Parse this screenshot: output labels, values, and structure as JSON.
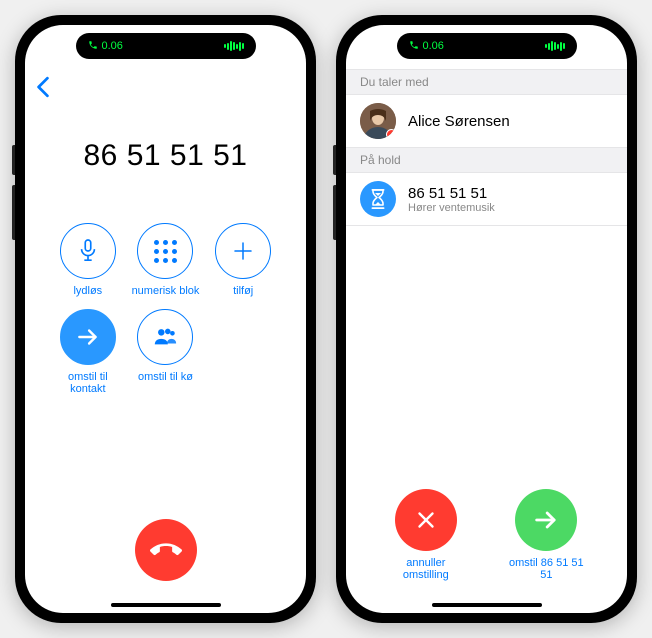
{
  "statusBar": {
    "time": "0.06"
  },
  "left": {
    "phoneNumber": "86 51 51 51",
    "buttons": {
      "mute": "lydløs",
      "keypad": "numerisk blok",
      "add": "tilføj",
      "transferContact": "omstil til kontakt",
      "transferQueue": "omstil til kø"
    }
  },
  "right": {
    "sections": {
      "talkingWith": "Du taler med",
      "onHold": "På hold"
    },
    "activeCall": {
      "name": "Alice Sørensen"
    },
    "holdCall": {
      "number": "86 51 51 51",
      "status": "Hører ventemusik"
    },
    "actions": {
      "cancel": "annuller omstilling",
      "transfer": "omstil 86 51 51 51"
    }
  }
}
